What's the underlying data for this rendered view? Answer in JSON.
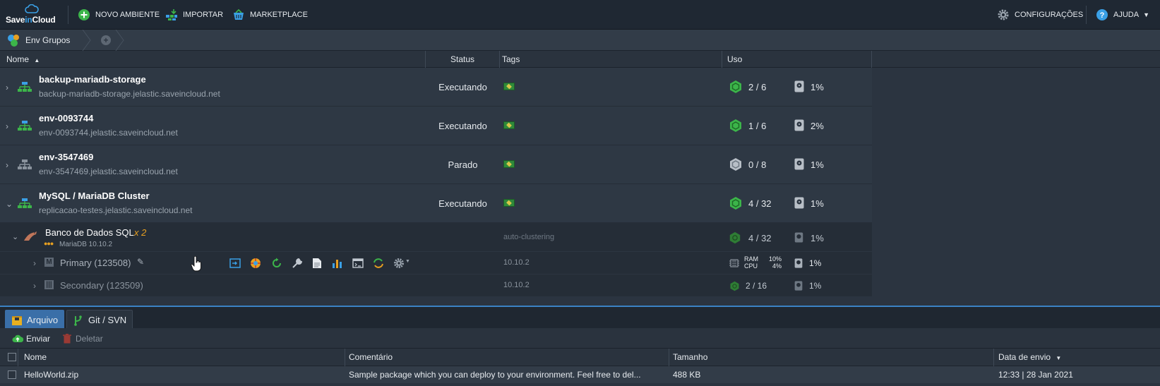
{
  "topbar": {
    "logo_prefix": "Save",
    "logo_mid": "in",
    "logo_suffix": "Cloud",
    "new_env": "NOVO AMBIENTE",
    "import": "IMPORTAR",
    "marketplace": "MARKETPLACE",
    "settings": "CONFIGURAÇÕES",
    "help": "AJUDA"
  },
  "breadcrumb": {
    "groups": "Env Grupos"
  },
  "grid": {
    "headers": {
      "name": "Nome",
      "status": "Status",
      "tags": "Tags",
      "usage": "Uso"
    },
    "envs": [
      {
        "name": "backup-mariadb-storage",
        "domain": "backup-mariadb-storage.jelastic.saveincloud.net",
        "status": "Executando",
        "cloudlets": "2 / 6",
        "disk": "1%",
        "running": true
      },
      {
        "name": "env-0093744",
        "domain": "env-0093744.jelastic.saveincloud.net",
        "status": "Executando",
        "cloudlets": "1 / 6",
        "disk": "2%",
        "running": true
      },
      {
        "name": "env-3547469",
        "domain": "env-3547469.jelastic.saveincloud.net",
        "status": "Parado",
        "cloudlets": "0 / 8",
        "disk": "1%",
        "running": false
      },
      {
        "name": "MySQL / MariaDB Cluster",
        "domain": "replicacao-testes.jelastic.saveincloud.net",
        "status": "Executando",
        "cloudlets": "4 / 32",
        "disk": "1%",
        "running": true
      }
    ],
    "layer": {
      "name": "Banco de Dados SQL",
      "count": "x 2",
      "version": "MariaDB 10.10.2",
      "tag": "auto-clustering",
      "cloudlets": "4 / 32",
      "disk": "1%"
    },
    "nodes": [
      {
        "name": "Primary (123508)",
        "tag": "10.10.2",
        "ram_label": "RAM",
        "ram": "10%",
        "cpu_label": "CPU",
        "cpu": "4%",
        "disk": "1%"
      },
      {
        "name": "Secondary (123509)",
        "tag": "10.10.2",
        "cloudlets": "2 / 16",
        "disk": "1%"
      }
    ]
  },
  "deploy": {
    "tabs": {
      "archive": "Arquivo",
      "git": "Git / SVN"
    },
    "toolbar": {
      "upload": "Enviar",
      "delete": "Deletar"
    },
    "headers": {
      "name": "Nome",
      "comment": "Comentário",
      "size": "Tamanho",
      "date": "Data de envio"
    },
    "files": [
      {
        "name": "HelloWorld.zip",
        "comment": "Sample package which you can deploy to your environment. Feel free to del...",
        "size": "488 KB",
        "date": "12:33 | 28 Jan 2021"
      }
    ]
  },
  "colors": {
    "accent": "#3b82c4",
    "running": "#3cb54a",
    "stopped": "#9aa4ae",
    "orange": "#e8a020"
  }
}
